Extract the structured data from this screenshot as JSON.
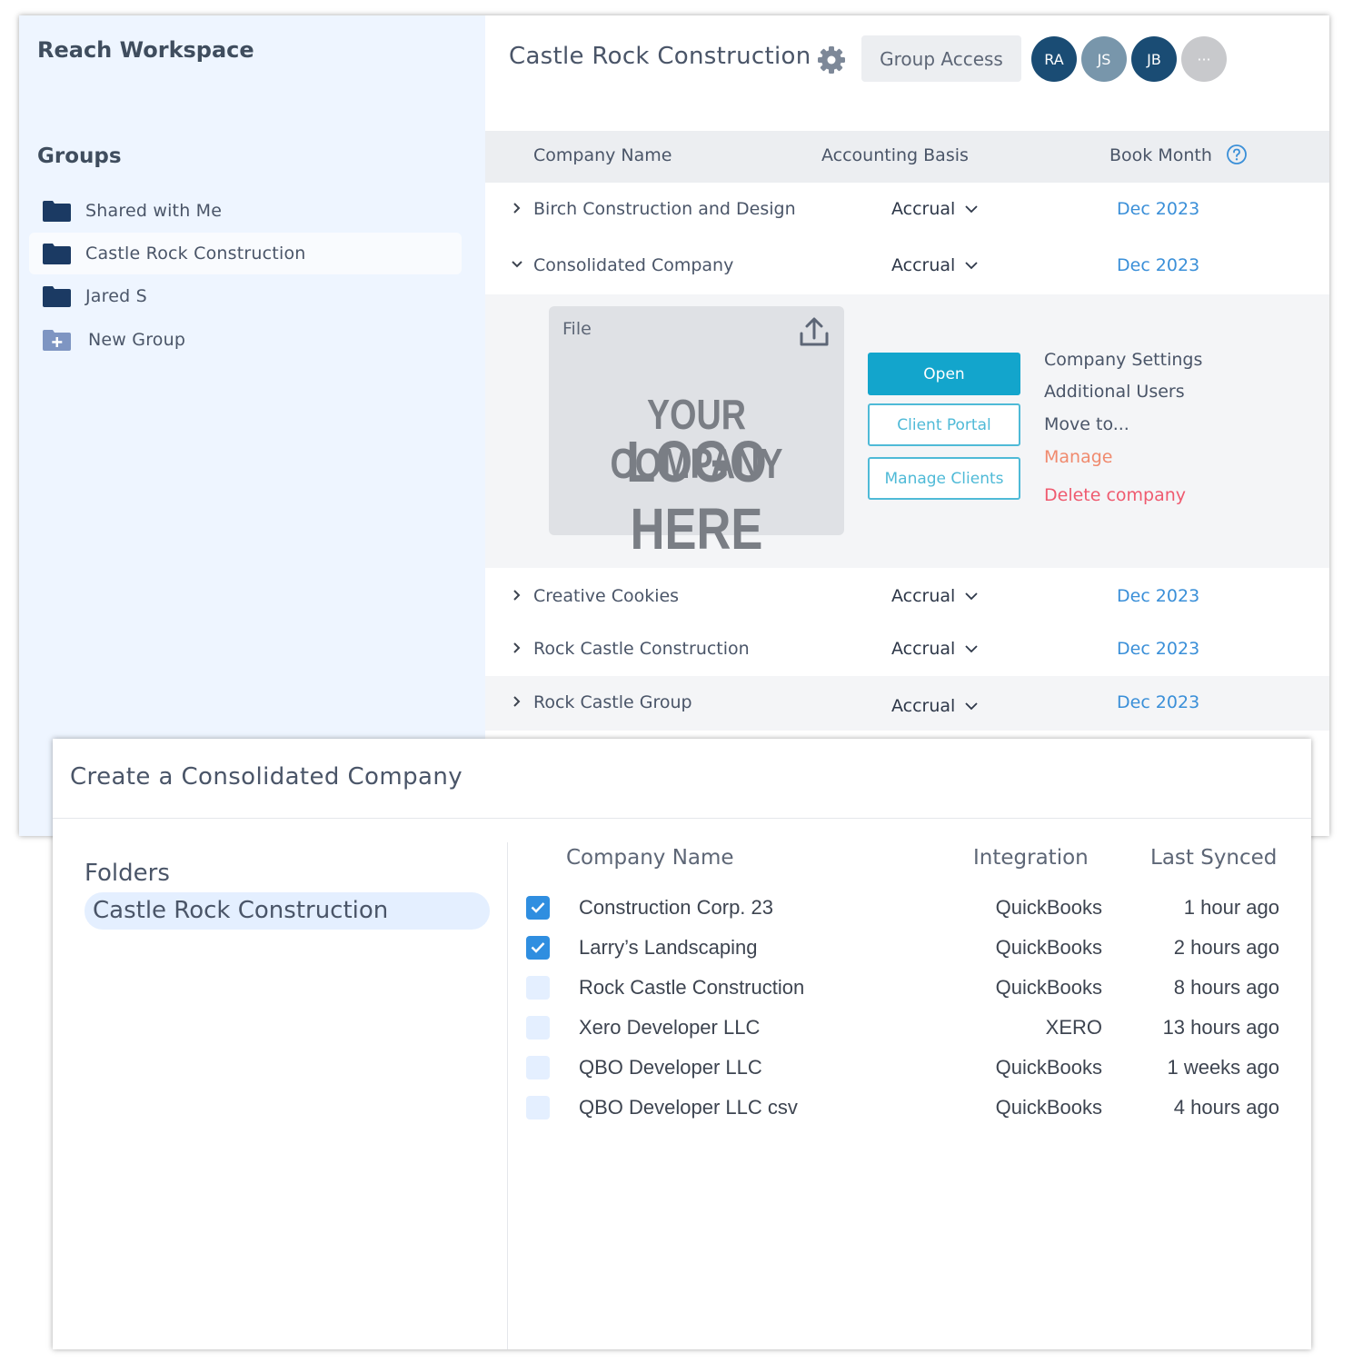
{
  "sidebar": {
    "workspace_title": "Reach Workspace",
    "groups_title": "Groups",
    "items": [
      {
        "label": "Shared with Me"
      },
      {
        "label": "Castle Rock Construction"
      },
      {
        "label": "Jared S"
      },
      {
        "label": "New Group"
      }
    ]
  },
  "header": {
    "title": "Castle Rock Construction",
    "group_access_label": "Group Access",
    "avatars": [
      {
        "initials": "RA",
        "color": "#1a4c74"
      },
      {
        "initials": "JS",
        "color": "#7896ab"
      },
      {
        "initials": "JB",
        "color": "#1a4c74"
      },
      {
        "initials": "···",
        "color": "#c8c9cc"
      }
    ]
  },
  "table": {
    "headers": {
      "company": "Company Name",
      "basis": "Accounting Basis",
      "month": "Book Month"
    },
    "rows": [
      {
        "name": "Birch Construction and Design",
        "basis": "Accrual",
        "month": "Dec 2023"
      },
      {
        "name": "Consolidated Company",
        "basis": "Accrual",
        "month": "Dec 2023"
      },
      {
        "name": "Creative Cookies",
        "basis": "Accrual",
        "month": "Dec 2023"
      },
      {
        "name": "Rock Castle Construction",
        "basis": "Accrual",
        "month": "Dec 2023"
      },
      {
        "name": "Rock Castle Group",
        "basis": "Accrual",
        "month": "Dec 2023"
      }
    ]
  },
  "expanded": {
    "file_label": "File",
    "logo_line1": "YOUR COMPANY",
    "logo_line2": "LOGO HERE",
    "buttons": {
      "open": "Open",
      "client_portal": "Client Portal",
      "manage_clients": "Manage Clients"
    },
    "menu": {
      "company_settings": "Company Settings",
      "additional_users": "Additional Users",
      "move_to": "Move to...",
      "manage": "Manage",
      "delete": "Delete company"
    },
    "colors": {
      "manage": "#f08a6e",
      "delete": "#ef5a6f"
    }
  },
  "modal": {
    "title": "Create a Consolidated Company",
    "folders_title": "Folders",
    "selected_folder": "Castle Rock Construction",
    "headers": {
      "company": "Company Name",
      "integration": "Integration",
      "synced": "Last Synced"
    },
    "rows": [
      {
        "checked": true,
        "name": "Construction Corp. 23",
        "integration": "QuickBooks",
        "synced": "1 hour ago"
      },
      {
        "checked": true,
        "name": "Larry’s Landscaping",
        "integration": "QuickBooks",
        "synced": "2 hours ago"
      },
      {
        "checked": false,
        "name": "Rock Castle Construction",
        "integration": "QuickBooks",
        "synced": "8 hours ago"
      },
      {
        "checked": false,
        "name": "Xero Developer LLC",
        "integration": "XERO",
        "synced": "13 hours ago"
      },
      {
        "checked": false,
        "name": "QBO Developer LLC",
        "integration": "QuickBooks",
        "synced": "1 weeks ago"
      },
      {
        "checked": false,
        "name": "QBO Developer LLC csv",
        "integration": "QuickBooks",
        "synced": "4 hours ago"
      }
    ]
  }
}
